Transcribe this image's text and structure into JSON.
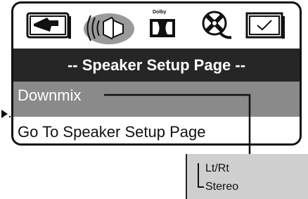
{
  "icons": [
    {
      "name": "general-setup-icon"
    },
    {
      "name": "speaker-setup-icon",
      "active": true
    },
    {
      "name": "dolby-digital-icon",
      "label": "Dolby"
    },
    {
      "name": "video-setup-icon"
    },
    {
      "name": "preference-check-icon"
    }
  ],
  "menu": {
    "title": "-- Speaker Setup Page --",
    "selected_item": "Downmix",
    "link_item": "Go To Speaker Setup Page"
  },
  "popup": {
    "options": [
      "Lt/Rt",
      "Stereo"
    ]
  },
  "colors": {
    "title_bg": "#262626",
    "selected_bg": "#8a8a8a",
    "popup_bg": "#cfcfcf",
    "active_icon_bg": "#9a9a9a"
  }
}
